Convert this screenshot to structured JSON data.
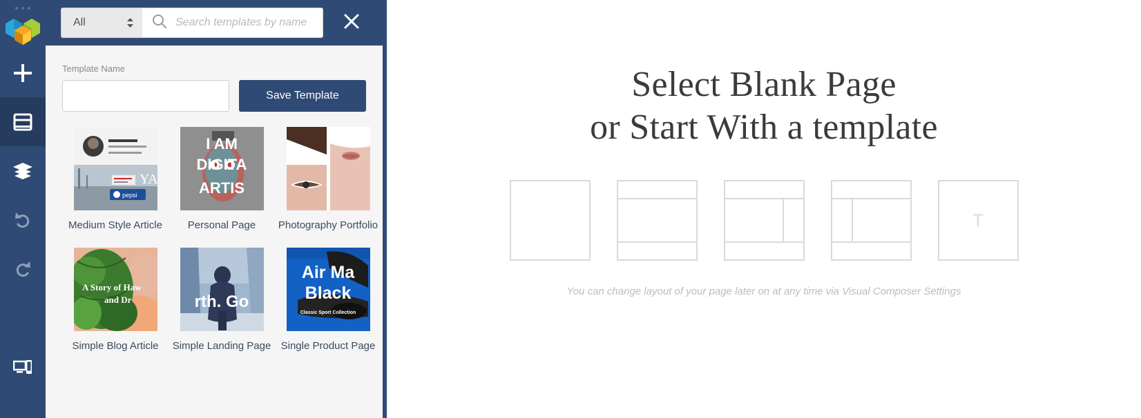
{
  "sidebar": {
    "logo": "visual-composer-cubes-logo",
    "items": [
      {
        "id": "add",
        "icon": "plus-icon",
        "active": false
      },
      {
        "id": "templates",
        "icon": "templates-icon",
        "active": true
      },
      {
        "id": "layers",
        "icon": "layers-icon",
        "active": false
      },
      {
        "id": "undo",
        "icon": "undo-icon",
        "active": false
      },
      {
        "id": "redo",
        "icon": "redo-icon",
        "active": false
      },
      {
        "id": "responsive-preview",
        "icon": "devices-icon",
        "active": false
      }
    ]
  },
  "panel": {
    "filter": {
      "selected": "All",
      "options": [
        "All"
      ]
    },
    "search": {
      "value": "",
      "placeholder": "Search templates by name"
    },
    "close_label": "✕",
    "template_name_label": "Template Name",
    "template_name_value": "",
    "template_name_placeholder": "",
    "save_label": "Save Template",
    "templates": [
      {
        "name": "Medium Style Article",
        "thumb": "medium-style-article-thumb"
      },
      {
        "name": "Personal Page",
        "thumb": "personal-page-thumb"
      },
      {
        "name": "Photography Portfolio",
        "thumb": "photography-portfolio-thumb"
      },
      {
        "name": "Simple Blog Article",
        "thumb": "simple-blog-article-thumb"
      },
      {
        "name": "Simple Landing Page",
        "thumb": "simple-landing-page-thumb"
      },
      {
        "name": "Single Product Page",
        "thumb": "single-product-page-thumb"
      }
    ]
  },
  "canvas": {
    "heading_line1": "Select Blank Page",
    "heading_line2": "or Start With a template",
    "layouts": [
      {
        "id": "blank",
        "type": "blank",
        "letter": ""
      },
      {
        "id": "header-content-footer",
        "type": "header-footer",
        "letter": ""
      },
      {
        "id": "header-content-right-sidebar-footer",
        "type": "header-right-footer",
        "letter": ""
      },
      {
        "id": "header-left-sidebar-content-footer",
        "type": "header-left-footer",
        "letter": ""
      },
      {
        "id": "theme-template",
        "type": "letter",
        "letter": "T"
      }
    ],
    "hint": "You can change layout of your page later on at any time via Visual Composer Settings"
  },
  "colors": {
    "sidebar_bg": "#2f4a74",
    "sidebar_active": "#263c5e",
    "panel_bg": "#f5f5f5",
    "label_text": "#3a4a62",
    "layout_border": "#d9d9d9",
    "hint_text": "#b9bcc0"
  }
}
